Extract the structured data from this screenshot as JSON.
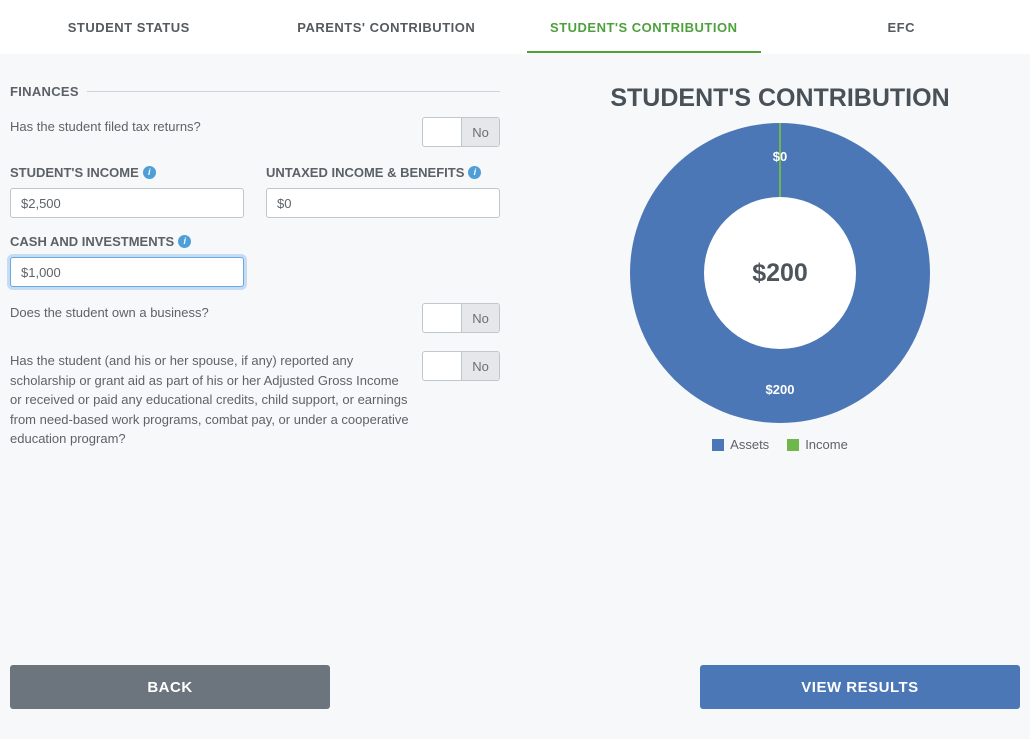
{
  "tabs": [
    {
      "label": "STUDENT STATUS",
      "active": false
    },
    {
      "label": "PARENTS' CONTRIBUTION",
      "active": false
    },
    {
      "label": "STUDENT'S CONTRIBUTION",
      "active": true
    },
    {
      "label": "EFC",
      "active": false
    }
  ],
  "section": {
    "title": "FINANCES"
  },
  "form": {
    "filed_returns_question": "Has the student filed tax returns?",
    "filed_returns_value": "No",
    "income_label": "STUDENT'S INCOME",
    "income_value": "$2,500",
    "untaxed_label": "UNTAXED INCOME & BENEFITS",
    "untaxed_value": "$0",
    "cash_label": "CASH AND INVESTMENTS",
    "cash_value": "$1,000",
    "owns_business_question": "Does the student own a business?",
    "owns_business_value": "No",
    "scholarship_question": "Has the student (and his or her spouse, if any) reported any scholarship or grant aid as part of his or her Adjusted Gross Income or received or paid any educational credits, child support, or earnings from need-based work programs, combat pay, or under a cooperative education program?",
    "scholarship_value": "No"
  },
  "chart": {
    "title": "STUDENT'S CONTRIBUTION",
    "center": "$200",
    "top_label": "$0",
    "bottom_label": "$200",
    "legend": {
      "assets": "Assets",
      "income": "Income"
    }
  },
  "chart_data": {
    "type": "pie",
    "title": "Student's Contribution",
    "series": [
      {
        "name": "Assets",
        "value": 200,
        "label": "$200",
        "color": "#4b77b6"
      },
      {
        "name": "Income",
        "value": 0,
        "label": "$0",
        "color": "#6fb74a"
      }
    ],
    "total_label": "$200"
  },
  "buttons": {
    "back": "BACK",
    "view_results": "VIEW RESULTS"
  },
  "colors": {
    "accent_green": "#4da03c",
    "blue": "#4b77b6",
    "gray_btn": "#6c757d"
  }
}
